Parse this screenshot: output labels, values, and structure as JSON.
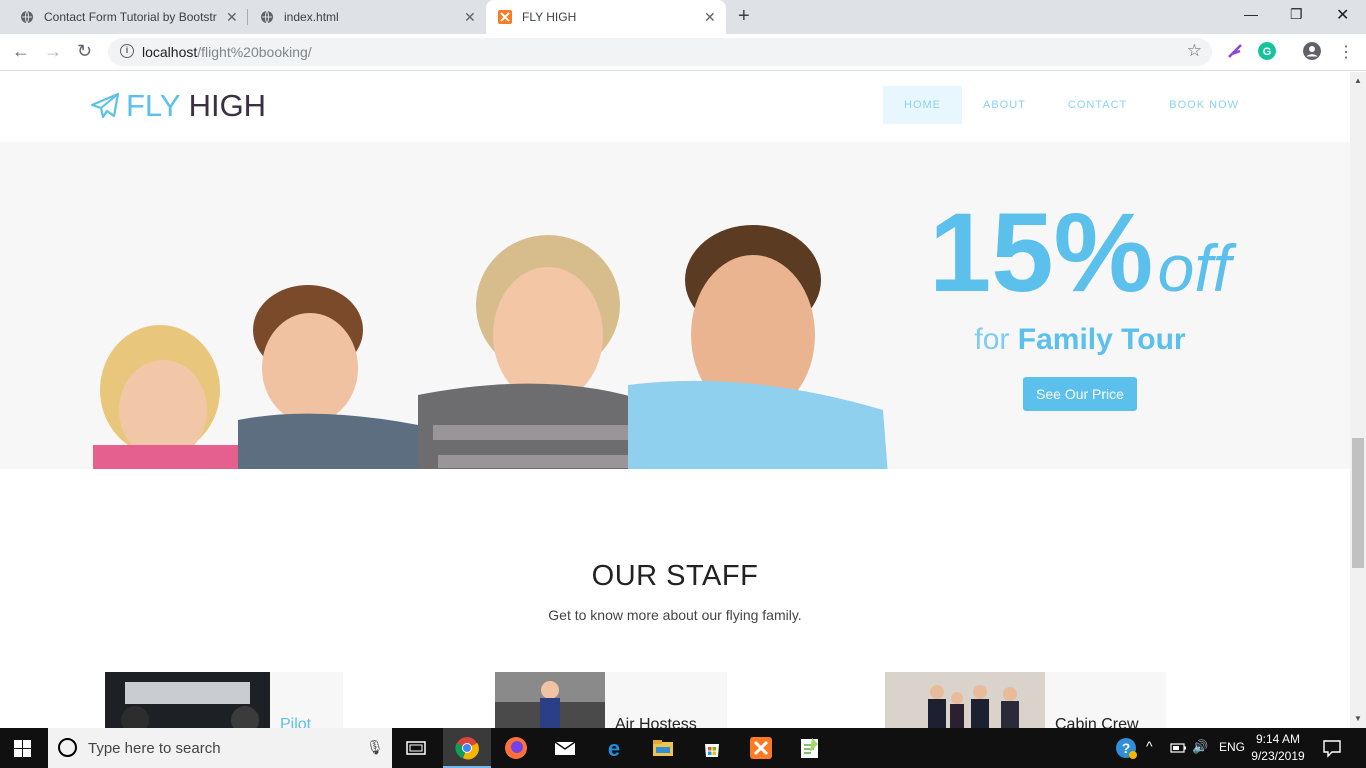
{
  "browser": {
    "tabs": [
      {
        "title": "Contact Form Tutorial by Bootstr"
      },
      {
        "title": "index.html"
      },
      {
        "title": "FLY HIGH"
      }
    ],
    "address": {
      "host": "localhost",
      "path": "/flight%20booking/"
    }
  },
  "site": {
    "logo": {
      "brand_part1": "FLY",
      "brand_part2": "HIGH"
    },
    "nav": [
      {
        "label": "HOME"
      },
      {
        "label": "ABOUT"
      },
      {
        "label": "CONTACT"
      },
      {
        "label": "BOOK NOW"
      }
    ],
    "hero": {
      "discount": "15%",
      "discount_suffix": "off",
      "subtitle_prefix": "for",
      "subtitle_strong": "Family Tour",
      "cta_label": "See Our Price"
    },
    "staff": {
      "heading": "OUR STAFF",
      "subheading": "Get to know more about our flying family.",
      "cards": [
        {
          "title": "Pilot"
        },
        {
          "title": "Air Hostess"
        },
        {
          "title": "Cabin Crew"
        }
      ]
    }
  },
  "taskbar": {
    "search_placeholder": "Type here to search",
    "language": "ENG",
    "time": "9:14 AM",
    "date": "9/23/2019"
  },
  "colors": {
    "accent": "#5bc0eb",
    "dark": "#3a3042"
  }
}
